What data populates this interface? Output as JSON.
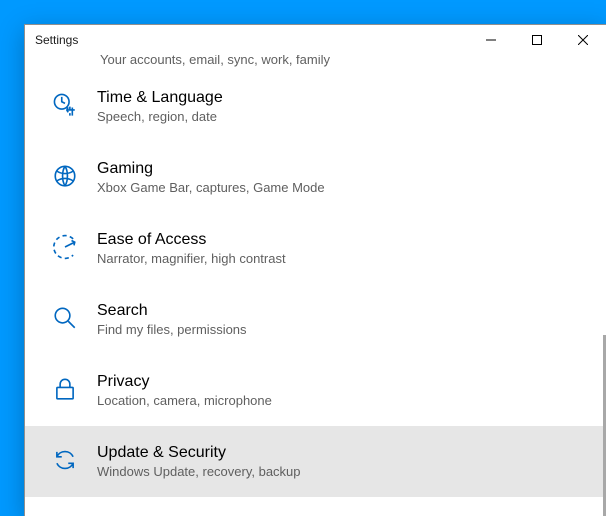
{
  "window": {
    "title": "Settings"
  },
  "partial_item": {
    "sub": "Your accounts, email, sync, work, family"
  },
  "items": [
    {
      "title": "Time & Language",
      "sub": "Speech, region, date"
    },
    {
      "title": "Gaming",
      "sub": "Xbox Game Bar, captures, Game Mode"
    },
    {
      "title": "Ease of Access",
      "sub": "Narrator, magnifier, high contrast"
    },
    {
      "title": "Search",
      "sub": "Find my files, permissions"
    },
    {
      "title": "Privacy",
      "sub": "Location, camera, microphone"
    },
    {
      "title": "Update & Security",
      "sub": "Windows Update, recovery, backup"
    }
  ],
  "selected_index": 5
}
